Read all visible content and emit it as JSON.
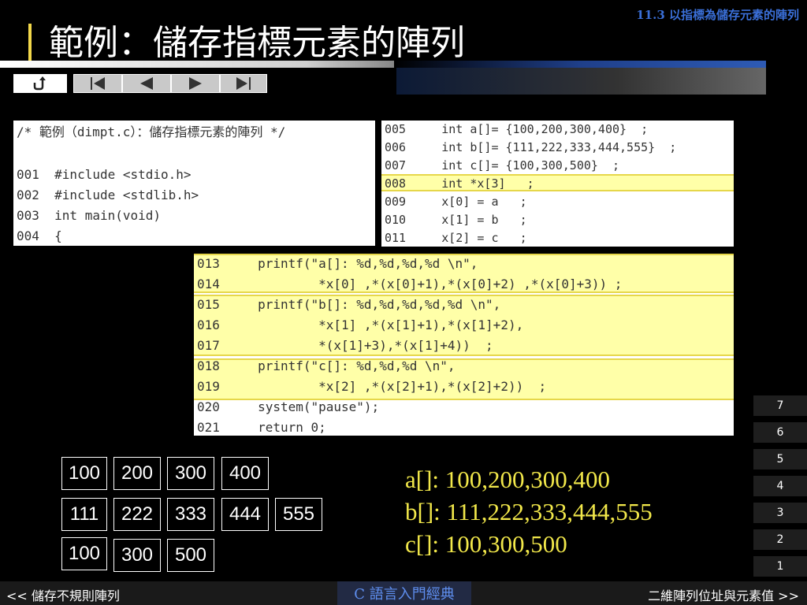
{
  "section_ref": "11.3  以指標為儲存元素的陣列",
  "title": "範例：儲存指標元素的陣列",
  "nav": {
    "icons": [
      "return-icon",
      "first-slide-icon",
      "prev-slide-icon",
      "next-slide-icon",
      "last-slide-icon"
    ]
  },
  "code_block_1": {
    "lines": [
      "/* 範例（dimpt.c）：儲存指標元素的陣列 */",
      "",
      "001  #include <stdio.h>",
      "002  #include <stdlib.h>",
      "003  int main(void)",
      "004  {"
    ]
  },
  "code_block_2": {
    "lines": [
      "005     int a[]= {100,200,300,400}  ;",
      "006     int b[]= {111,222,333,444,555}  ;",
      "007     int c[]= {100,300,500}  ;",
      "008     int *x[3]   ;",
      "009     x[0] = a   ;",
      "010     x[1] = b   ;",
      "011     x[2] = c   ;"
    ]
  },
  "code_block_3": {
    "lines": [
      "013     printf(\"a[]: %d,%d,%d,%d \\n\",",
      "014             *x[0] ,*(x[0]+1),*(x[0]+2) ,*(x[0]+3)) ;",
      "015     printf(\"b[]: %d,%d,%d,%d,%d \\n\",",
      "016             *x[1] ,*(x[1]+1),*(x[1]+2),",
      "017             *(x[1]+3),*(x[1]+4))  ;",
      "018     printf(\"c[]: %d,%d,%d \\n\",",
      "019             *x[2] ,*(x[2]+1),*(x[2]+2))  ;",
      "020     system(\"pause\");",
      "021     return 0;"
    ]
  },
  "arrays": {
    "a": [
      "100",
      "200",
      "300",
      "400"
    ],
    "b": [
      "111",
      "222",
      "333",
      "444",
      "555"
    ],
    "c": [
      "100",
      "300",
      "500"
    ]
  },
  "output": [
    "a[]: 100,200,300,400",
    "b[]: 111,222,333,444,555",
    "c[]: 100,300,500"
  ],
  "slides": [
    "7",
    "6",
    "5",
    "4",
    "3",
    "2",
    "1"
  ],
  "footer": {
    "prev": "<< 儲存不規則陣列",
    "center": "C 語言入門經典",
    "next": "二維陣列位址與元素值 >>"
  },
  "colors": {
    "highlight": "#ffff99",
    "output_text": "#f2e84a",
    "section_ref": "#3a6fd8"
  }
}
